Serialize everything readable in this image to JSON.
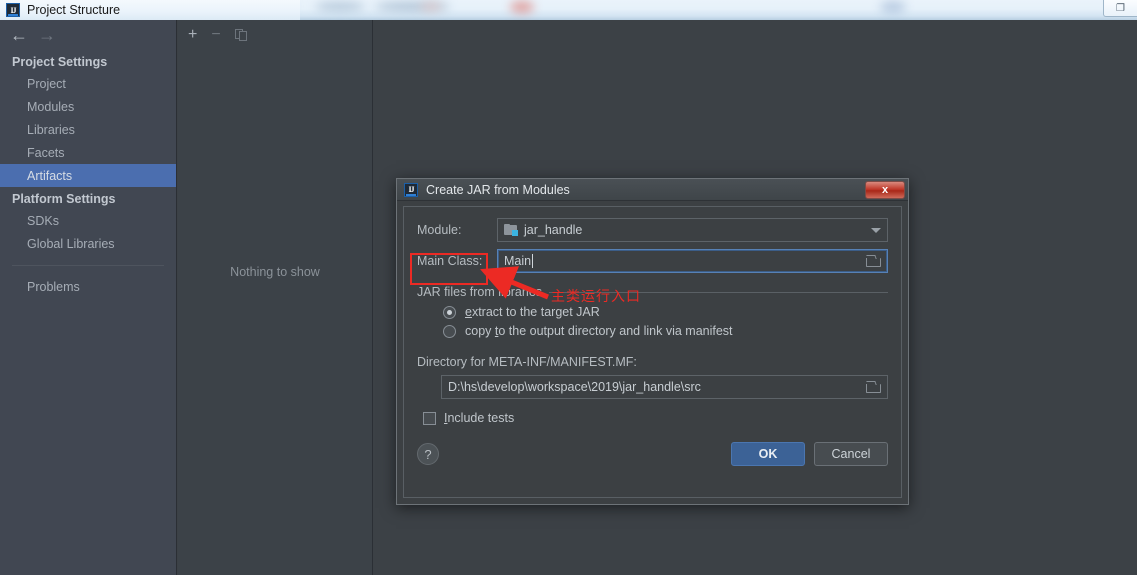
{
  "window": {
    "title": "Project Structure",
    "logo_text": "IJ",
    "restore_button": "❐"
  },
  "sidebar": {
    "nav": {
      "back_icon": "←",
      "forward_icon": "→"
    },
    "groups": [
      {
        "title": "Project Settings",
        "items": [
          "Project",
          "Modules",
          "Libraries",
          "Facets",
          "Artifacts"
        ]
      },
      {
        "title": "Platform Settings",
        "items": [
          "SDKs",
          "Global Libraries"
        ]
      }
    ],
    "selected": "Artifacts",
    "problems": "Problems"
  },
  "mid_panel": {
    "toolbar": {
      "add": "+",
      "remove": "−",
      "copy": "copy-icon"
    },
    "empty_text": "Nothing to show"
  },
  "dialog": {
    "title": "Create JAR from Modules",
    "logo_text": "IJ",
    "close_label": "x",
    "module": {
      "label": "Module:",
      "value": "jar_handle",
      "dropdown_icon": "chevron-down-icon"
    },
    "main_class": {
      "label": "Main Class:",
      "value": "Main",
      "browse_icon": "folder-icon"
    },
    "jar_group": {
      "label": "JAR files from libraries",
      "options": [
        {
          "text_before": "",
          "mnemonic": "e",
          "text_after": "xtract to the target JAR",
          "checked": true
        },
        {
          "text_before": "copy ",
          "mnemonic": "t",
          "text_after": "o the output directory and link via manifest",
          "checked": false
        }
      ]
    },
    "directory": {
      "label": "Directory for META-INF/MANIFEST.MF:",
      "value": "D:\\hs\\develop\\workspace\\2019\\jar_handle\\src",
      "browse_icon": "folder-icon"
    },
    "include_tests": {
      "label_before": "",
      "mnemonic": "I",
      "label_after": "nclude tests",
      "checked": false
    },
    "buttons": {
      "help": "?",
      "ok": "OK",
      "cancel": "Cancel"
    }
  },
  "annotations": {
    "note_text": "主类运行入口",
    "highlight_color": "#ec2a24"
  }
}
